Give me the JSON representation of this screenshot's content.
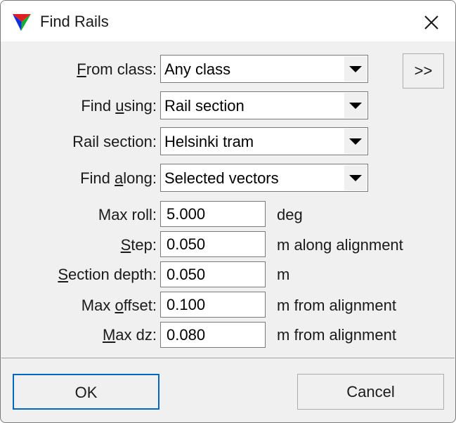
{
  "window": {
    "title": "Find Rails"
  },
  "form": {
    "from_class": {
      "label_pre": "",
      "label_key": "F",
      "label_post": "rom class:",
      "value": "Any class",
      "more_label": ">>"
    },
    "find_using": {
      "label_pre": "Find ",
      "label_key": "u",
      "label_post": "sing:",
      "value": "Rail section"
    },
    "rail_section": {
      "label": "Rail section:",
      "value": "Helsinki tram"
    },
    "find_along": {
      "label_pre": "Find ",
      "label_key": "a",
      "label_post": "long:",
      "value": "Selected vectors"
    },
    "max_roll": {
      "label": "Max roll:",
      "value": "5.000",
      "unit": "deg"
    },
    "step": {
      "label_pre": "",
      "label_key": "S",
      "label_post": "tep:",
      "value": "0.050",
      "unit": "m along alignment"
    },
    "section_depth": {
      "label_pre": "",
      "label_key": "S",
      "label_post": "ection depth:",
      "value": "0.050",
      "unit": "m"
    },
    "max_offset": {
      "label_pre": "Max ",
      "label_key": "o",
      "label_post": "ffset:",
      "value": "0.100",
      "unit": "m from alignment"
    },
    "max_dz": {
      "label_pre": "",
      "label_key": "M",
      "label_post": "ax dz:",
      "value": "0.080",
      "unit": "m from alignment"
    }
  },
  "buttons": {
    "ok": "OK",
    "cancel": "Cancel"
  }
}
